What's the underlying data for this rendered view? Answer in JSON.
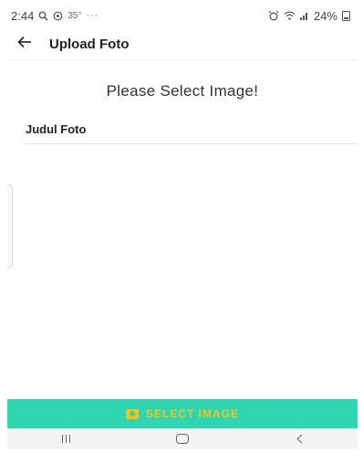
{
  "status_bar": {
    "time": "2:44",
    "temperature": "35°",
    "more": "···",
    "battery_percent": "24%"
  },
  "app_bar": {
    "title": "Upload Foto"
  },
  "content": {
    "prompt": "Please Select Image!",
    "field_label": "Judul Foto"
  },
  "actions": {
    "select_image_label": "SELECT IMAGE"
  },
  "colors": {
    "accent": "#2fd6b0",
    "button_text": "#f4c21f"
  },
  "icons": {
    "back": "arrow-left-icon",
    "camera": "camera-icon",
    "recent": "recent-apps-icon",
    "home": "home-icon",
    "nav_back": "chevron-left-icon"
  }
}
